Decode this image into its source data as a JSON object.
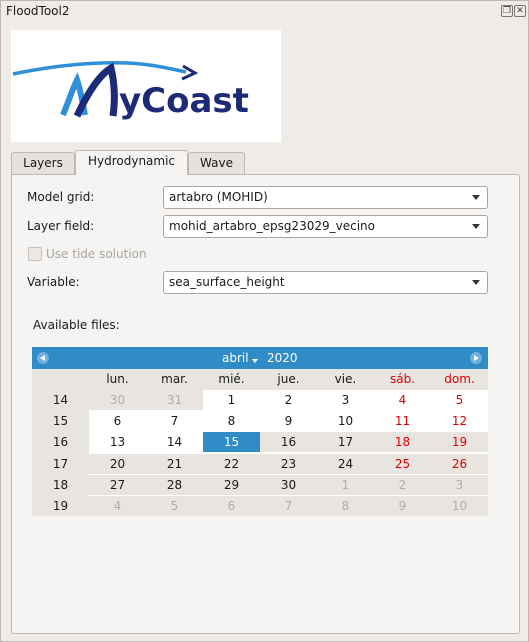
{
  "window": {
    "title": "FloodTool2"
  },
  "logo": {
    "text": "MyCoast",
    "accent_dark": "#1c2a78",
    "accent_light": "#2f8fd8"
  },
  "tabs": [
    {
      "label": "Layers",
      "active": false
    },
    {
      "label": "Hydrodynamic",
      "active": true
    },
    {
      "label": "Wave",
      "active": false
    }
  ],
  "form": {
    "model_grid_label": "Model grid:",
    "model_grid_value": "artabro (MOHID)",
    "layer_field_label": "Layer field:",
    "layer_field_value": "mohid_artabro_epsg23029_vecino",
    "use_tide_label": "Use tide solution",
    "variable_label": "Variable:",
    "variable_value": "sea_surface_height",
    "available_files_label": "Available files:"
  },
  "calendar": {
    "month": "abril",
    "year": "2020",
    "weekdays": [
      "lun.",
      "mar.",
      "mié.",
      "jue.",
      "vie.",
      "sáb.",
      "dom."
    ],
    "weeks": [
      {
        "num": "14",
        "days": [
          "30",
          "31",
          "1",
          "2",
          "3",
          "4",
          "5"
        ]
      },
      {
        "num": "15",
        "days": [
          "6",
          "7",
          "8",
          "9",
          "10",
          "11",
          "12"
        ]
      },
      {
        "num": "16",
        "days": [
          "13",
          "14",
          "15",
          "16",
          "17",
          "18",
          "19"
        ]
      },
      {
        "num": "17",
        "days": [
          "20",
          "21",
          "22",
          "23",
          "24",
          "25",
          "26"
        ]
      },
      {
        "num": "18",
        "days": [
          "27",
          "28",
          "29",
          "30",
          "1",
          "2",
          "3"
        ]
      },
      {
        "num": "19",
        "days": [
          "4",
          "5",
          "6",
          "7",
          "8",
          "9",
          "10"
        ]
      }
    ],
    "selected_day": "15",
    "colors": {
      "header": "#308cc6",
      "weekend": "#e00000",
      "selected": "#308cc6",
      "other_month": "#b0aca8",
      "unavailable_bg": "#e8e4e0"
    }
  }
}
